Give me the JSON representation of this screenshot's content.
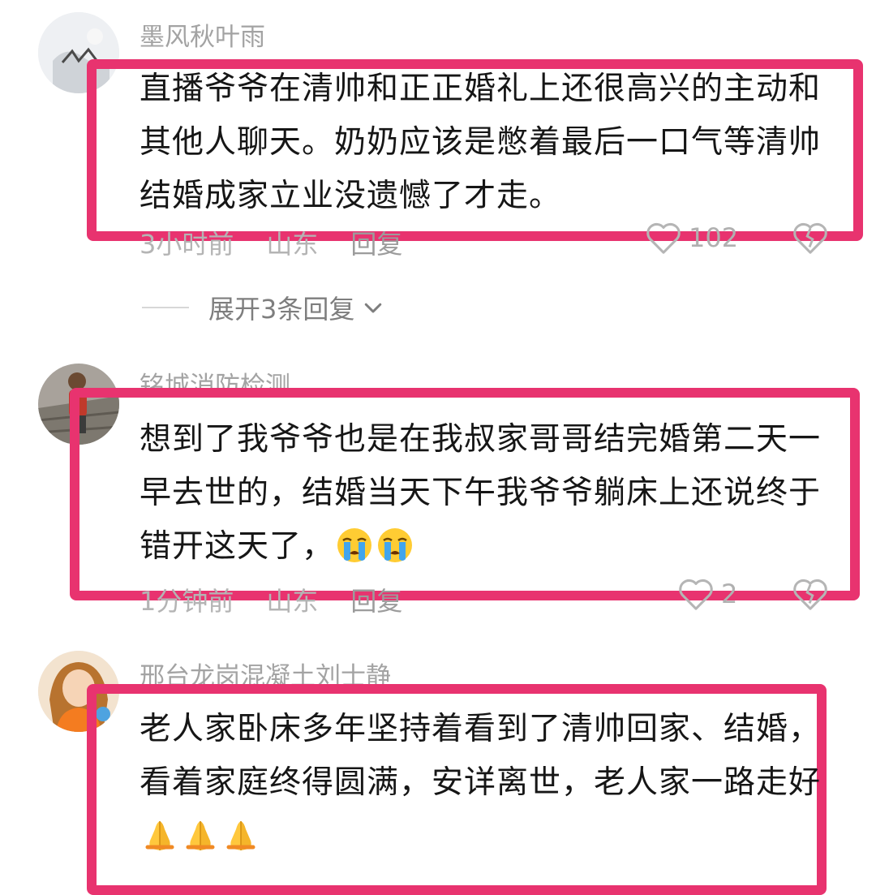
{
  "comments": [
    {
      "username": "墨风秋叶雨",
      "text": "直播爷爷在清帅和正正婚礼上还很高兴的主动和其他人聊天。奶奶应该是憋着最后一口气等清帅结婚成家立业没遗憾了才走。",
      "time": "3小时前",
      "location": "山东",
      "reply": "回复",
      "likes": "102"
    },
    {
      "username": "铭城消防检测",
      "text": "想到了我爷爷也是在我叔家哥哥结完婚第二天一早去世的，结婚当天下午我爷爷躺床上还说终于错开这天了，",
      "emojis": [
        "crying-face",
        "crying-face"
      ],
      "time": "1分钟前",
      "location": "山东",
      "reply": "回复",
      "likes": "2"
    },
    {
      "username": "邢台龙岗混凝土刘士静",
      "text": "老人家卧床多年坚持着看到了清帅回家、结婚，看着家庭终得圆满，安详离世，老人家一路走好",
      "emojis": [
        "folded-hands",
        "folded-hands",
        "folded-hands"
      ]
    }
  ],
  "expand_replies": "展开3条回复",
  "highlight_color": "#e8336f"
}
